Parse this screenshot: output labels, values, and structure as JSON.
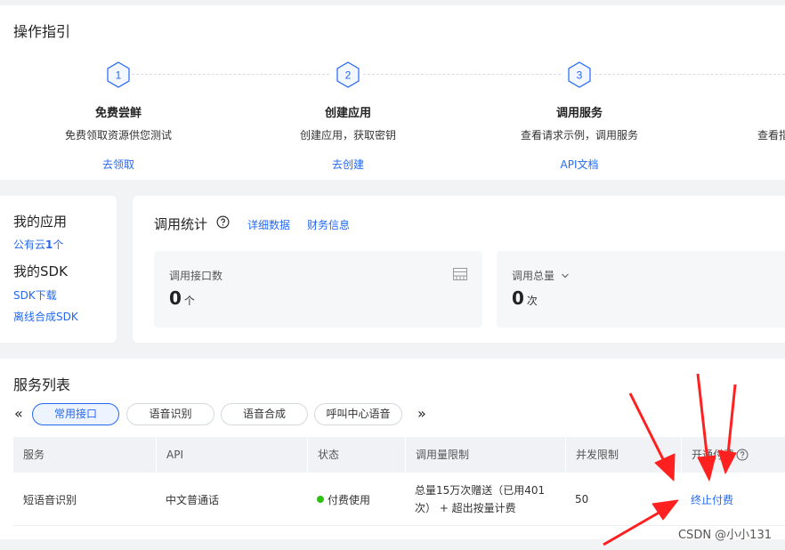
{
  "guide": {
    "title": "操作指引",
    "steps": [
      {
        "num": "1",
        "title": "免费尝鲜",
        "desc": "免费领取资源供您测试",
        "link": "去领取"
      },
      {
        "num": "2",
        "title": "创建应用",
        "desc": "创建应用，获取密钥",
        "link": "去创建"
      },
      {
        "num": "3",
        "title": "调用服务",
        "desc": "查看请求示例，调用服务",
        "link": "API文档"
      }
    ],
    "step4_partial": "查看指"
  },
  "my_app": {
    "apps_heading": "我的应用",
    "public_cloud_prefix": "公有云",
    "public_cloud_count": "1",
    "public_cloud_suffix": "个",
    "sdk_heading": "我的SDK",
    "sdk_download": "SDK下载",
    "offline_sdk": "离线合成SDK"
  },
  "stats": {
    "title": "调用统计",
    "detail_link": "详细数据",
    "finance_link": "财务信息",
    "api_count_label": "调用接口数",
    "api_count_value": "0",
    "api_count_unit": "个",
    "total_calls_label": "调用总量",
    "total_calls_value": "0",
    "total_calls_unit": "次"
  },
  "services": {
    "title": "服务列表",
    "prev_arrow": "«",
    "next_arrow": "»",
    "tabs": [
      "常用接口",
      "语音识别",
      "语音合成",
      "呼叫中心语音"
    ],
    "active_tab": "常用接口",
    "columns": [
      "服务",
      "API",
      "状态",
      "调用量限制",
      "并发限制",
      "开通付费"
    ],
    "rows": [
      {
        "service": "短语音识别",
        "api": "中文普通话",
        "status": "付费使用",
        "limit": "总量15万次赠送（已用401次） + 超出按量计费",
        "concurrency": "50",
        "action": "终止付费"
      }
    ]
  },
  "watermark": "CSDN @小小131",
  "colors": {
    "accent": "#2468f2",
    "status_green": "#30bf13",
    "arrow_red": "#ff2020"
  }
}
